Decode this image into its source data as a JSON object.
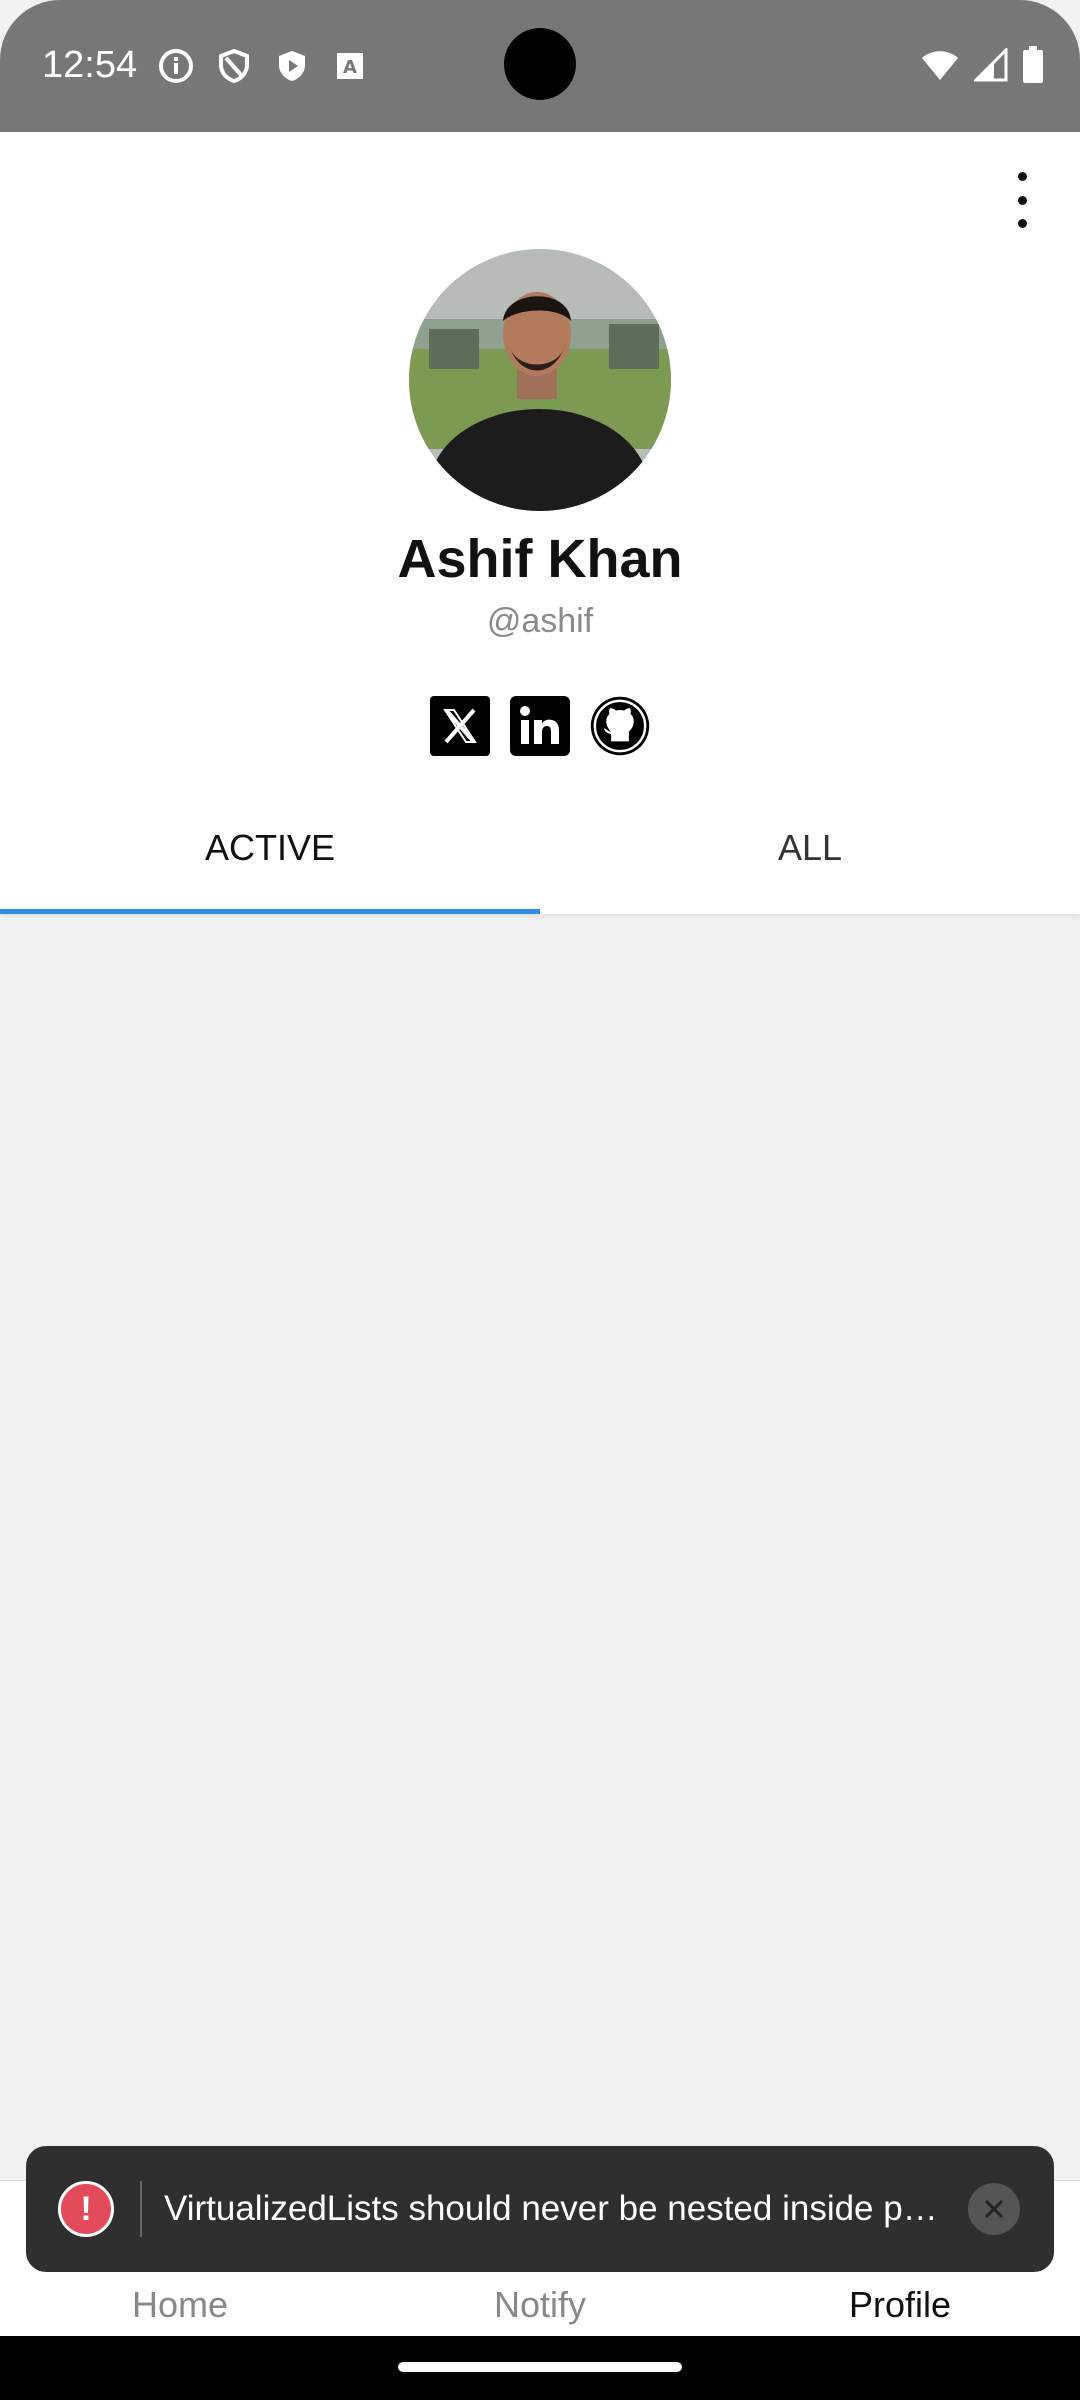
{
  "status_bar": {
    "time": "12:54",
    "icons": [
      "info-icon",
      "shield-icon",
      "play-protect-icon",
      "a-icon"
    ],
    "right_icons": [
      "wifi-icon",
      "signal-icon",
      "battery-icon"
    ]
  },
  "profile": {
    "name": "Ashif Khan",
    "handle": "@ashif",
    "socials": [
      "x-icon",
      "linkedin-icon",
      "github-icon"
    ]
  },
  "tabs": [
    {
      "label": "ACTIVE",
      "active": true
    },
    {
      "label": "ALL",
      "active": false
    }
  ],
  "toast": {
    "message": "VirtualizedLists should never be nested inside plain ScrollViews"
  },
  "bottom_nav": [
    {
      "label": "Home",
      "active": false
    },
    {
      "label": "Notify",
      "active": false
    },
    {
      "label": "Profile",
      "active": true
    }
  ],
  "colors": {
    "accent": "#2d8de8",
    "error": "#e34b5b",
    "status_bar": "#777777"
  }
}
